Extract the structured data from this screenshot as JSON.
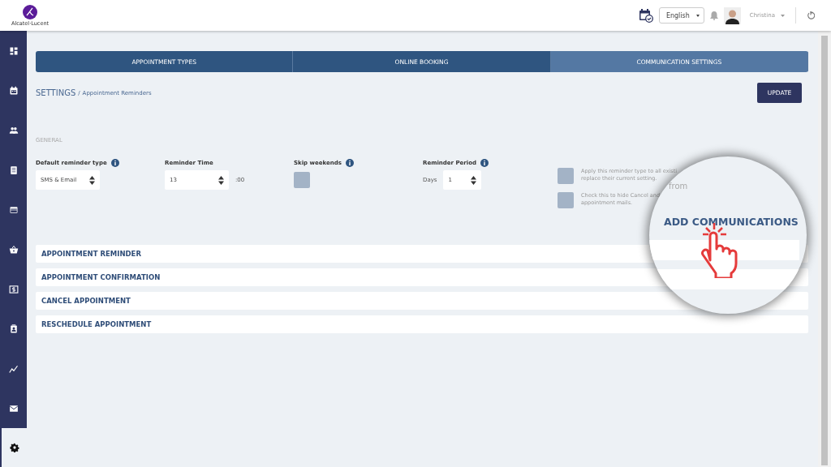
{
  "header": {
    "logo_text": "Alcatel·Lucent",
    "language": "English",
    "user": "Christina"
  },
  "sidebar": {
    "items": [
      {
        "kind": "dashboard",
        "selected": false
      },
      {
        "kind": "calendar",
        "selected": false
      },
      {
        "kind": "people",
        "selected": false
      },
      {
        "kind": "list",
        "selected": false
      },
      {
        "kind": "card",
        "selected": false
      },
      {
        "kind": "basket",
        "selected": false
      },
      {
        "kind": "dollar",
        "selected": false
      },
      {
        "kind": "contact",
        "selected": false
      },
      {
        "kind": "chart",
        "selected": false
      },
      {
        "kind": "mail",
        "selected": false
      },
      {
        "kind": "gear",
        "selected": true
      }
    ]
  },
  "tabs": [
    {
      "label": "APPOINTMENT TYPES",
      "selected": false
    },
    {
      "label": "ONLINE BOOKING",
      "selected": false
    },
    {
      "label": "COMMUNICATION SETTINGS",
      "selected": true
    }
  ],
  "breadcrumb": {
    "section": "SETTINGS",
    "separator": "/",
    "page": "Appointment Reminders"
  },
  "update_button": "UPDATE",
  "general": {
    "heading": "GENERAL",
    "fields": [
      {
        "kind": "select",
        "label": "Default reminder type",
        "info": true,
        "value": "SMS & Email"
      },
      {
        "kind": "select",
        "label": "Reminder Time",
        "info": false,
        "value": "13",
        "suffix": ":00"
      },
      {
        "kind": "checkbox",
        "label": "Skip weekends",
        "info": true,
        "checked": false
      },
      {
        "kind": "select",
        "label": "Reminder Period",
        "info": true,
        "prefix": "Days",
        "value": "1"
      }
    ],
    "options": [
      {
        "lines": [
          "Apply this reminder type to all existi",
          "replace their current setting."
        ],
        "checked": false
      },
      {
        "lines": [
          "Check this to hide Cancel and",
          "appointment mails."
        ],
        "checked": false
      }
    ]
  },
  "sections": [
    {
      "title": "APPOINTMENT REMINDER"
    },
    {
      "title": "APPOINTMENT CONFIRMATION"
    },
    {
      "title": "CANCEL APPOINTMENT"
    },
    {
      "title": "RESCHEDULE APPOINTMENT"
    }
  ],
  "magnifier": {
    "caption": "from",
    "title": "ADD COMMUNICATIONS"
  }
}
